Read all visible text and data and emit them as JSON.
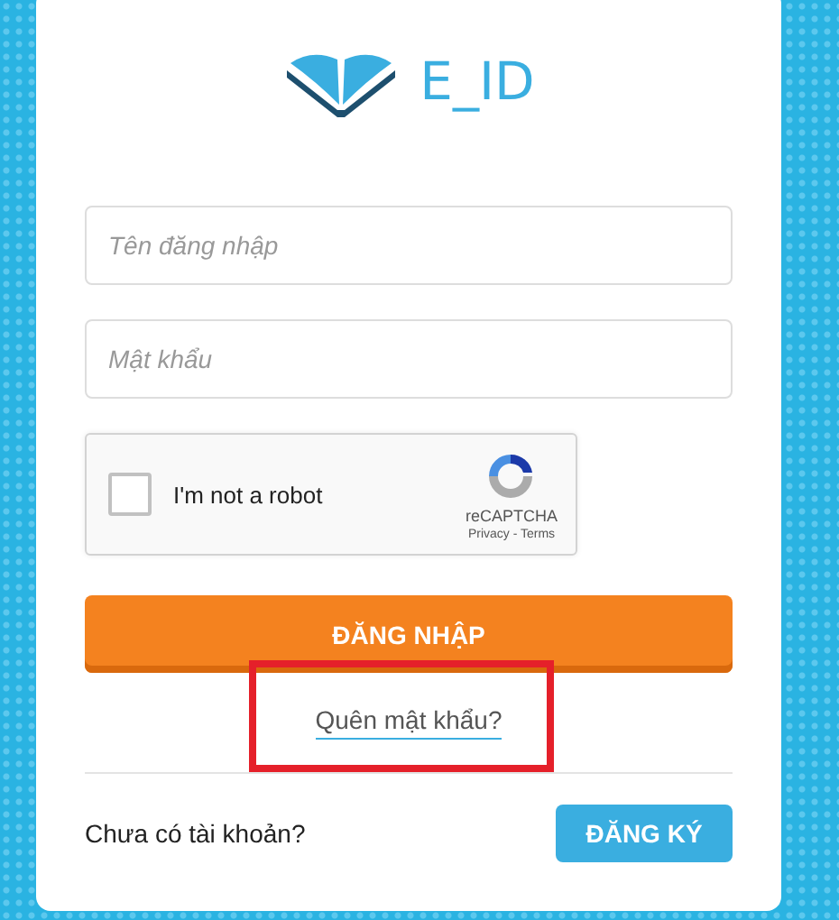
{
  "logo": {
    "text": "E_ID"
  },
  "fields": [
    {
      "placeholder": "Tên đăng nhập"
    },
    {
      "placeholder": "Mật khẩu"
    }
  ],
  "captcha": {
    "label": "I'm not a robot",
    "checked": false,
    "brand": "reCAPTCHA",
    "links": "Privacy - Terms"
  },
  "login_button": "ĐĂNG NHẬP",
  "forgot_link": {
    "text": "Quên mật khẩu?",
    "highlighted": true
  },
  "signup": {
    "prompt": "Chưa có tài khoản?",
    "button": "ĐĂNG KÝ"
  }
}
